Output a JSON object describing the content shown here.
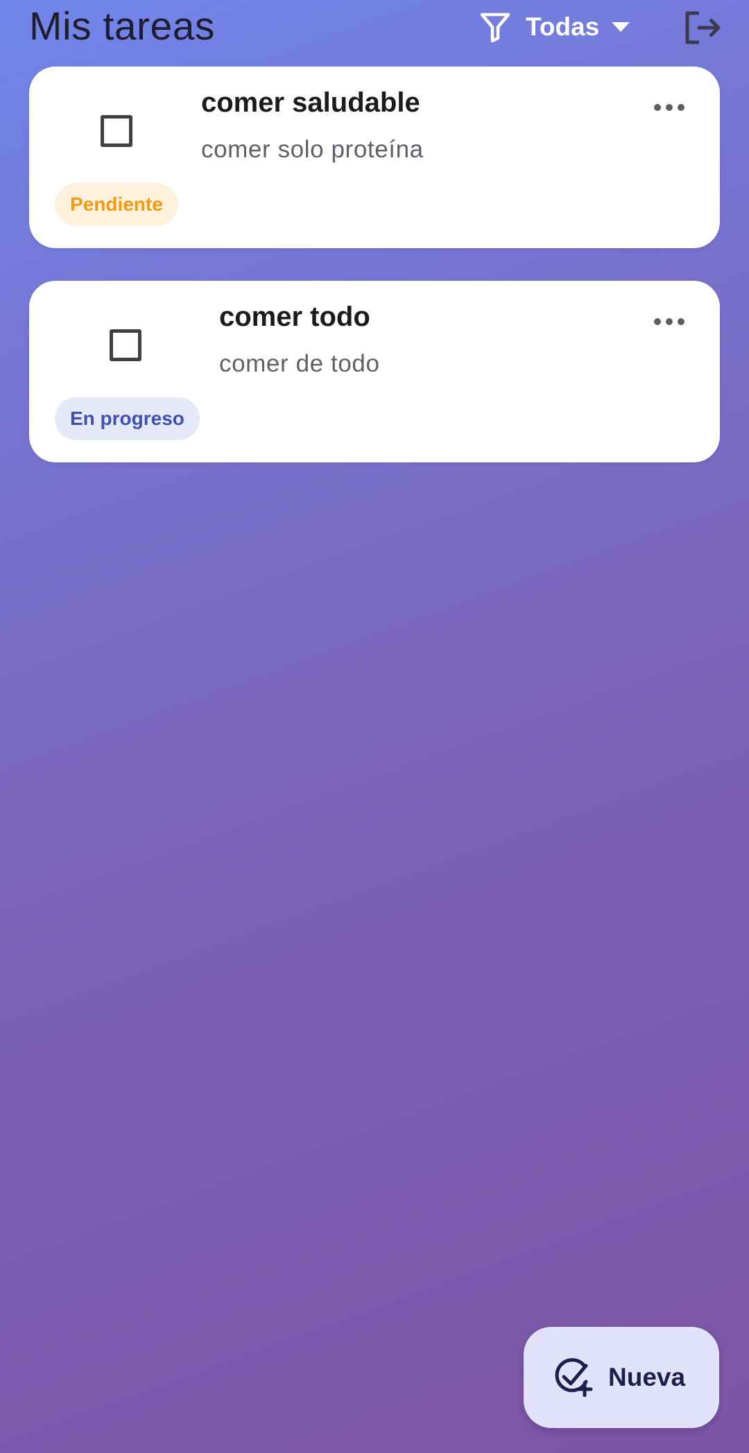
{
  "header": {
    "title": "Mis tareas",
    "filter_label": "Todas",
    "icons": {
      "filter": "filter-icon",
      "dropdown": "caret-down-icon",
      "logout": "logout-icon"
    }
  },
  "tasks": [
    {
      "title": "comer saludable",
      "description": "comer solo proteína",
      "status": "Pendiente",
      "checked": false
    },
    {
      "title": "comer todo",
      "description": "comer de todo",
      "status": "En progreso",
      "checked": false
    }
  ],
  "fab": {
    "label": "Nueva",
    "icon": "add-task-icon"
  },
  "colors": {
    "background_top": "#7086ea",
    "background_bottom": "#7d54a6",
    "card": "#ffffff",
    "pending_text": "#f39c12",
    "pending_bg": "#fdf0dc",
    "progress_text": "#3f51b5",
    "progress_bg": "#e6e9f8",
    "fab_bg": "#e2e2fa"
  }
}
